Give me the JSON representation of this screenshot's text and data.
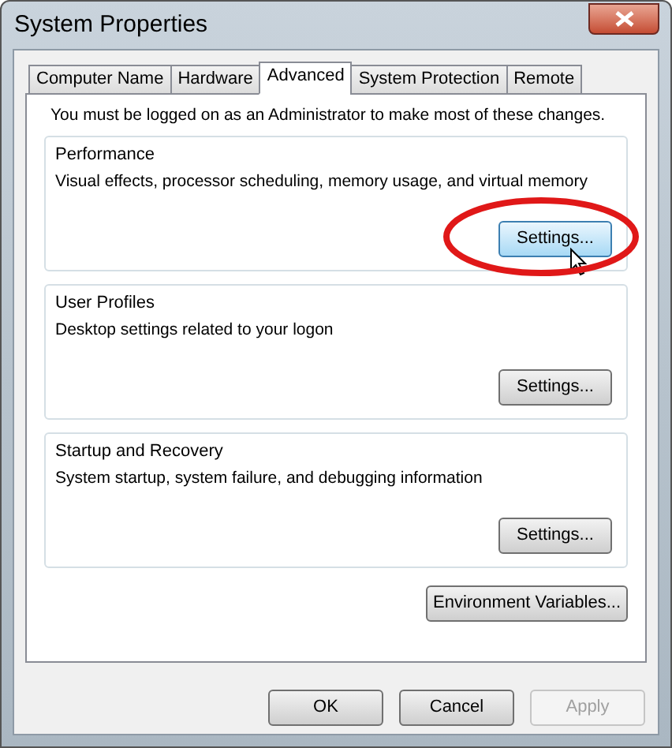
{
  "window": {
    "title": "System Properties"
  },
  "tabs": [
    {
      "label": "Computer Name",
      "selected": false
    },
    {
      "label": "Hardware",
      "selected": false
    },
    {
      "label": "Advanced",
      "selected": true
    },
    {
      "label": "System Protection",
      "selected": false
    },
    {
      "label": "Remote",
      "selected": false
    }
  ],
  "notice": "You must be logged on as an Administrator to make most of these changes.",
  "groups": [
    {
      "title": "Performance",
      "description": "Visual effects, processor scheduling, memory usage, and virtual memory",
      "button": {
        "label": "Settings...",
        "hovered": true,
        "circled": true
      }
    },
    {
      "title": "User Profiles",
      "description": "Desktop settings related to your logon",
      "button": {
        "label": "Settings...",
        "hovered": false,
        "circled": false
      }
    },
    {
      "title": "Startup and Recovery",
      "description": "System startup, system failure, and debugging information",
      "button": {
        "label": "Settings...",
        "hovered": false,
        "circled": false
      }
    }
  ],
  "environment_button": "Environment Variables...",
  "dialog_buttons": [
    {
      "label": "OK",
      "disabled": false
    },
    {
      "label": "Cancel",
      "disabled": false
    },
    {
      "label": "Apply",
      "disabled": true
    }
  ]
}
